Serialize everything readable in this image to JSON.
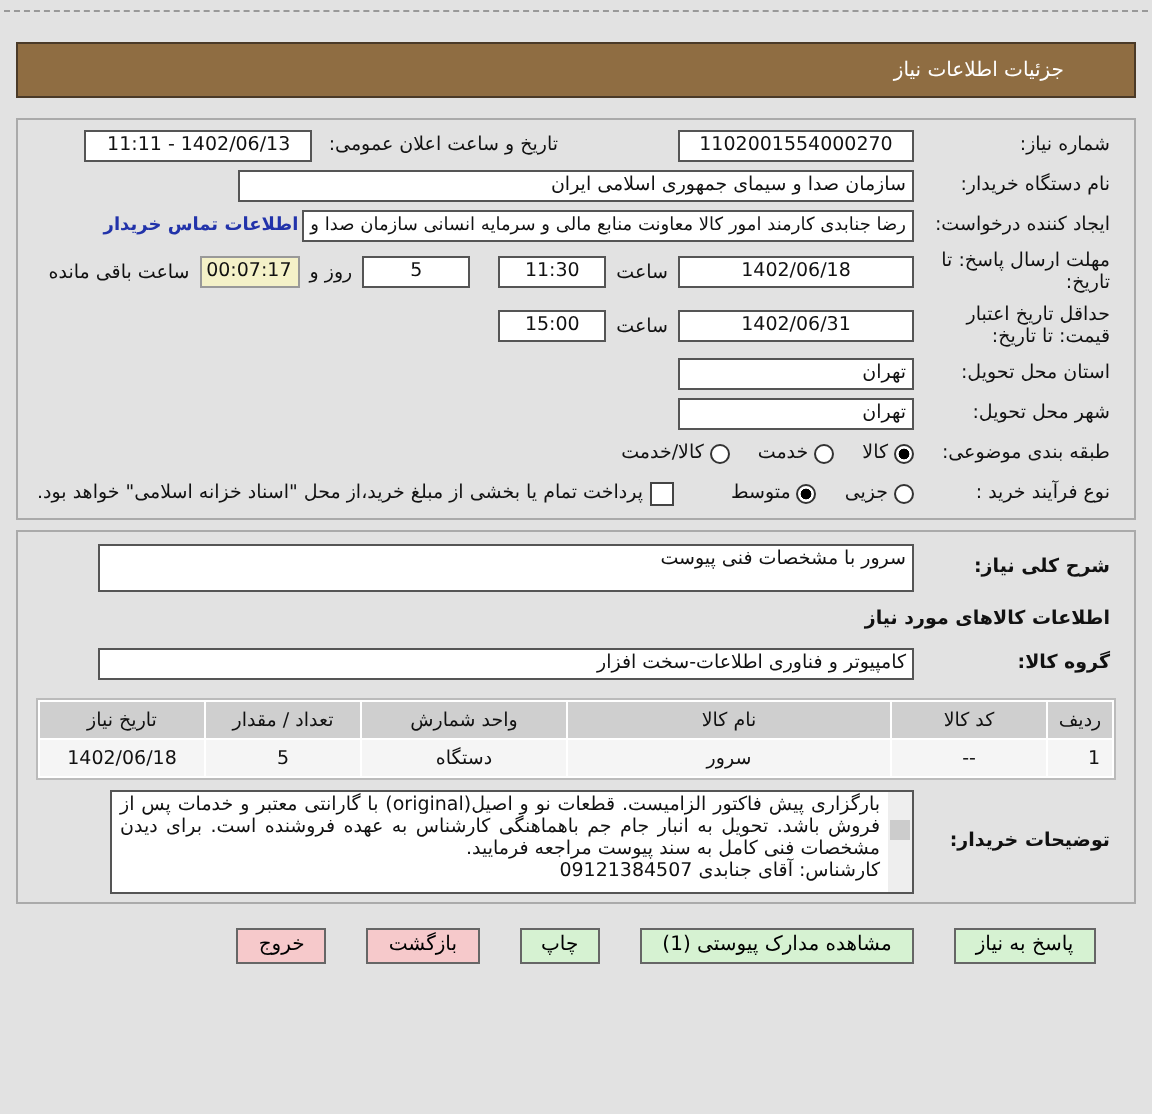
{
  "header": {
    "title": "جزئیات اطلاعات نیاز"
  },
  "info": {
    "need_number": {
      "label": "شماره نیاز:",
      "value": "1102001554000270"
    },
    "announce": {
      "label": "تاریخ و ساعت اعلان عمومی:",
      "value": "1402/06/13 - 11:11"
    },
    "buyer": {
      "label": "نام دستگاه خریدار:",
      "value": "سازمان صدا و سیمای جمهوری اسلامی ایران"
    },
    "creator": {
      "label": "ایجاد کننده درخواست:",
      "value": "رضا جنابدی کارمند امور کالا معاونت منابع مالی و سرمایه انسانی سازمان صدا و",
      "link": "اطلاعات تماس خریدار"
    },
    "deadline": {
      "label": "مهلت ارسال پاسخ: تا تاریخ:",
      "date": "1402/06/18",
      "time_label": "ساعت",
      "time": "11:30",
      "days": "5",
      "days_label": "روز و",
      "remaining": "00:07:17",
      "remaining_label": "ساعت باقی مانده"
    },
    "validity": {
      "label": "حداقل تاریخ اعتبار قیمت: تا تاریخ:",
      "date": "1402/06/31",
      "time_label": "ساعت",
      "time": "15:00"
    },
    "province": {
      "label": "استان محل تحویل:",
      "value": "تهران"
    },
    "city": {
      "label": "شهر محل تحویل:",
      "value": "تهران"
    },
    "category": {
      "label": "طبقه بندی موضوعی:",
      "options": [
        {
          "label": "کالا",
          "selected": true
        },
        {
          "label": "خدمت",
          "selected": false
        },
        {
          "label": "کالا/خدمت",
          "selected": false
        }
      ]
    },
    "process": {
      "label": "نوع فرآیند خرید :",
      "options": [
        {
          "label": "جزیی",
          "selected": false
        },
        {
          "label": "متوسط",
          "selected": true
        }
      ],
      "payment": {
        "label": "پرداخت تمام یا بخشی از مبلغ خرید،از محل \"اسناد خزانه اسلامی\" خواهد بود.",
        "checked": false
      }
    }
  },
  "needs": {
    "description": {
      "label": "شرح کلی نیاز:",
      "value": "سرور با مشخصات فنی پیوست"
    },
    "goods_title": "اطلاعات کالاهای مورد نیاز",
    "group": {
      "label": "گروه کالا:",
      "value": "کامپیوتر و فناوری اطلاعات-سخت افزار"
    },
    "table": {
      "columns": [
        "ردیف",
        "کد کالا",
        "نام کالا",
        "واحد شمارش",
        "تعداد / مقدار",
        "تاریخ نیاز"
      ],
      "rows": [
        [
          "1",
          "--",
          "سرور",
          "دستگاه",
          "5",
          "1402/06/18"
        ]
      ]
    },
    "notes": {
      "label": "توضیحات خریدار:",
      "text": "بارگزاری پیش فاکتور الزامیست. قطعات نو و اصیل(original) با گارانتی معتبر و خدمات پس از فروش باشد. تحویل به انبار جام جم  باهماهنگی کارشناس به عهده فروشنده است. برای دیدن مشخصات فنی کامل به سند پیوست مراجعه فرمایید.",
      "contact": "کارشناس: آقای جنابدی 09121384507"
    }
  },
  "buttons": [
    {
      "label": "پاسخ به نیاز",
      "kind": "primary"
    },
    {
      "label": "مشاهده مدارک پیوستی (1)",
      "kind": "primary"
    },
    {
      "label": "چاپ",
      "kind": "primary"
    },
    {
      "label": "بازگشت",
      "kind": "danger"
    },
    {
      "label": "خروج",
      "kind": "danger"
    }
  ]
}
